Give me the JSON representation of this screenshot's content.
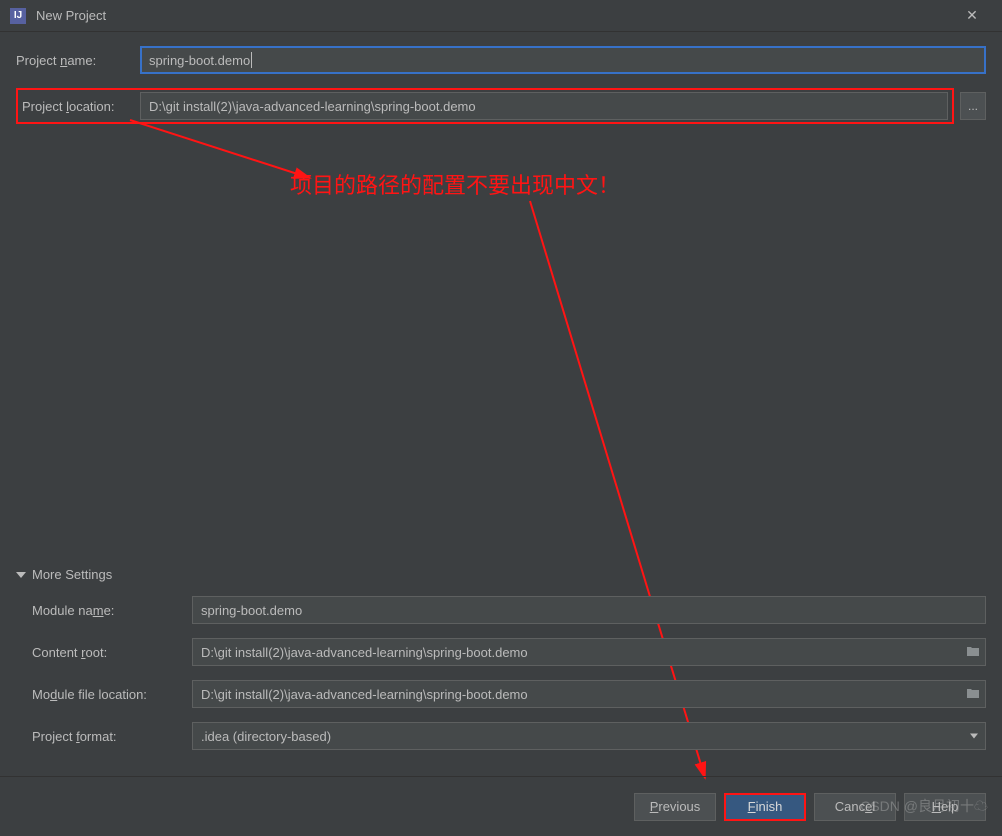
{
  "window": {
    "title": "New Project",
    "app_icon_letter": "IJ"
  },
  "fields": {
    "project_name_label_pre": "Project ",
    "project_name_label_u": "n",
    "project_name_label_post": "ame:",
    "project_name_value": "spring-boot.demo",
    "project_location_label_pre": "Project ",
    "project_location_label_u": "l",
    "project_location_label_post": "ocation:",
    "project_location_value": "D:\\git install(2)\\java-advanced-learning\\spring-boot.demo",
    "browse_label": "..."
  },
  "more_settings": {
    "header": "More Settings",
    "module_name_label_pre": "Module na",
    "module_name_label_u": "m",
    "module_name_label_post": "e:",
    "module_name_value": "spring-boot.demo",
    "content_root_label_pre": "Content ",
    "content_root_label_u": "r",
    "content_root_label_post": "oot:",
    "content_root_value": "D:\\git install(2)\\java-advanced-learning\\spring-boot.demo",
    "module_file_location_label_pre": "Mo",
    "module_file_location_label_u": "d",
    "module_file_location_label_post": "ule file location:",
    "module_file_location_value": "D:\\git install(2)\\java-advanced-learning\\spring-boot.demo",
    "project_format_label_pre": "Project ",
    "project_format_label_u": "f",
    "project_format_label_post": "ormat:",
    "project_format_value": ".idea (directory-based)"
  },
  "buttons": {
    "previous_u": "P",
    "previous_post": "revious",
    "finish_u": "F",
    "finish_post": "inish",
    "cancel_pre": "Canc",
    "cancel_u": "e",
    "cancel_post": "l",
    "help_u": "H",
    "help_post": "elp"
  },
  "annotations": {
    "red_note": "项目的路径的配置不要出现中文！"
  },
  "watermark": "CSDN @良月初十☁",
  "colors": {
    "accent_red": "#ff1414",
    "focus_blue": "#3771c8",
    "primary_btn": "#365880"
  }
}
